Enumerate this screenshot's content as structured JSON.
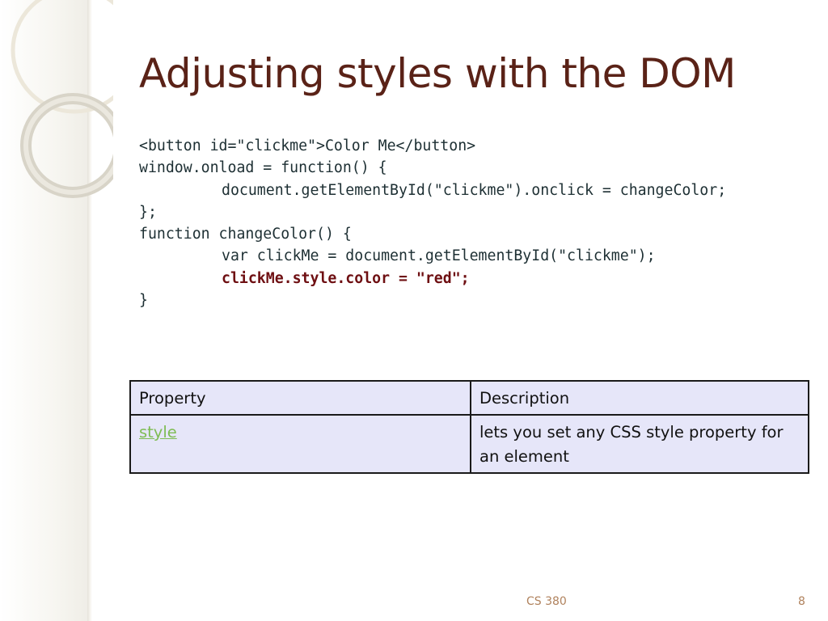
{
  "slide": {
    "title": "Adjusting styles with the DOM",
    "code_lines": [
      "<button id=\"clickme\">Color Me</button>",
      "window.onload = function() {",
      "document.getElementById(\"clickme\").onclick = changeColor;",
      "};",
      "function changeColor() {",
      "var clickMe = document.getElementById(\"clickme\");",
      "clickMe.style.color = \"red\";",
      "}"
    ],
    "table": {
      "headers": [
        "Property",
        "Description"
      ],
      "rows": [
        {
          "property": "style",
          "description": "lets you set any CSS style property for an element"
        }
      ]
    },
    "footer": {
      "course": "CS 380",
      "page_number": "8"
    }
  },
  "colors": {
    "title": "#5a2217",
    "code_text": "#1d2f33",
    "code_highlight": "#6e0f12",
    "table_cell_bg": "#e6e6f9",
    "link": "#7ebc53",
    "footer": "#b0825d"
  }
}
